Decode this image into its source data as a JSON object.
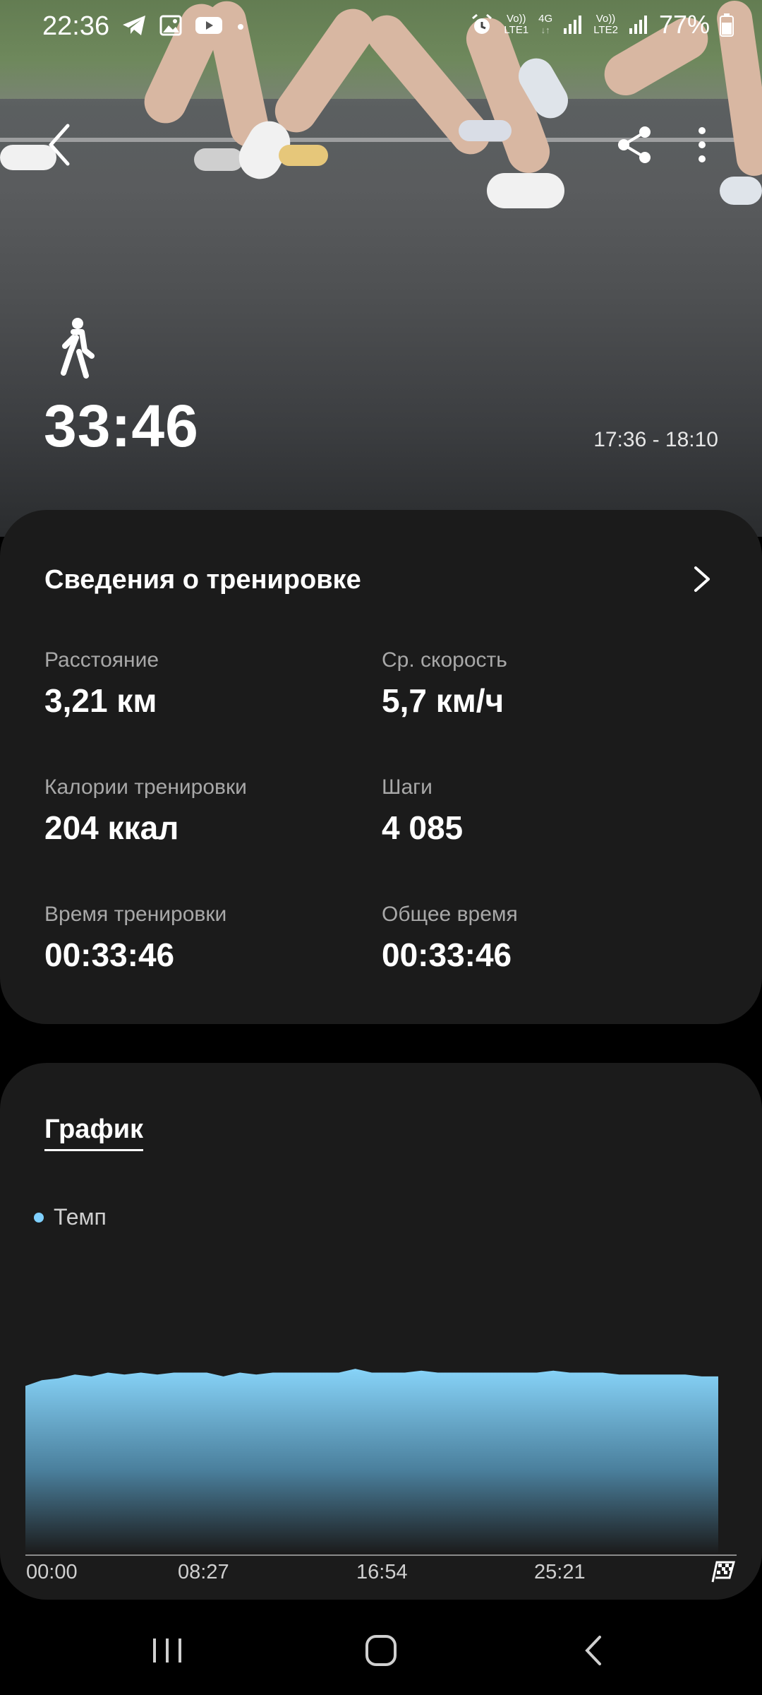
{
  "status_bar": {
    "time": "22:36",
    "battery": "77%",
    "sim1": {
      "top": "Vo))",
      "bottom": "LTE1"
    },
    "network": "4G",
    "sim2": {
      "top": "Vo))",
      "bottom": "LTE2"
    }
  },
  "hero": {
    "duration": "33:46",
    "time_range": "17:36 - 18:10"
  },
  "details": {
    "title": "Сведения о тренировке",
    "stats": [
      {
        "label": "Расстояние",
        "value": "3,21 км"
      },
      {
        "label": "Ср. скорость",
        "value": "5,7 км/ч"
      },
      {
        "label": "Калории тренировки",
        "value": "204 ккал"
      },
      {
        "label": "Шаги",
        "value": "4 085"
      },
      {
        "label": "Время тренировки",
        "value": "00:33:46"
      },
      {
        "label": "Общее время",
        "value": "00:33:46"
      }
    ]
  },
  "chart_section": {
    "title": "График",
    "legend": "Темп",
    "accent": "#7fd0ff"
  },
  "chart_data": {
    "type": "area",
    "series": [
      {
        "name": "Темп",
        "values": [
          0.88,
          0.91,
          0.92,
          0.94,
          0.93,
          0.95,
          0.94,
          0.95,
          0.94,
          0.95,
          0.95,
          0.95,
          0.93,
          0.95,
          0.94,
          0.95,
          0.95,
          0.95,
          0.95,
          0.95,
          0.97,
          0.95,
          0.95,
          0.95,
          0.96,
          0.95,
          0.95,
          0.95,
          0.95,
          0.95,
          0.95,
          0.95,
          0.96,
          0.95,
          0.95,
          0.95,
          0.94,
          0.94,
          0.94,
          0.94,
          0.94,
          0.93,
          0.93
        ]
      }
    ],
    "x_tick_labels": [
      "00:00",
      "08:27",
      "16:54",
      "25:21"
    ],
    "grid": false
  }
}
